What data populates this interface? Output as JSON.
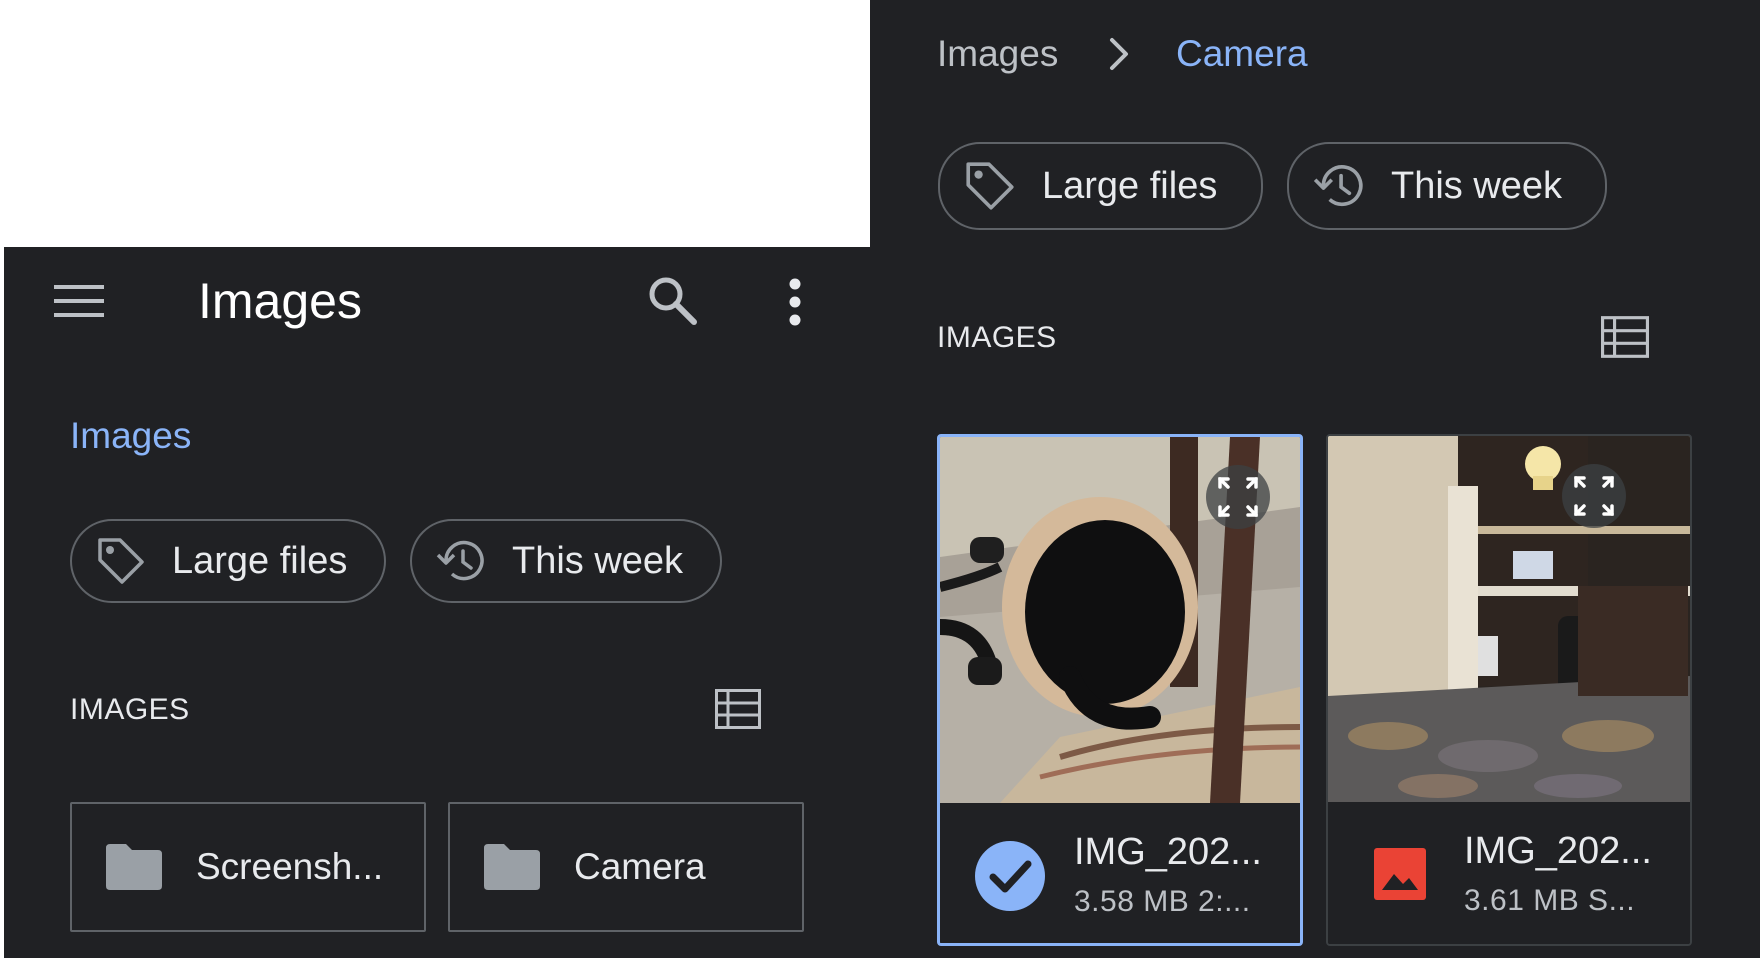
{
  "left_panel": {
    "toolbar": {
      "menu_icon": "menu-icon",
      "title": "Images",
      "search_icon": "search-icon",
      "overflow_icon": "more-vert-icon"
    },
    "breadcrumb": {
      "current": "Images"
    },
    "chips": [
      {
        "label": "Large files",
        "icon": "tag-icon"
      },
      {
        "label": "This week",
        "icon": "history-icon"
      }
    ],
    "section": {
      "label": "IMAGES",
      "view_icon": "list-view-icon"
    },
    "folders": [
      {
        "label": "Screensh...",
        "icon": "folder-icon"
      },
      {
        "label": "Camera",
        "icon": "folder-icon"
      }
    ]
  },
  "right_panel": {
    "breadcrumb": {
      "parent": "Images",
      "separator_icon": "chevron-right-icon",
      "current": "Camera"
    },
    "chips": [
      {
        "label": "Large files",
        "icon": "tag-icon"
      },
      {
        "label": "This week",
        "icon": "history-icon"
      }
    ],
    "section": {
      "label": "IMAGES",
      "view_icon": "list-view-icon"
    },
    "files": [
      {
        "name": "IMG_202...",
        "meta": "3.58 MB 2:...",
        "selected": true,
        "status_icon": "check-circle-icon",
        "expand_icon": "fullscreen-icon"
      },
      {
        "name": "IMG_202...",
        "meta": "3.61 MB S...",
        "selected": false,
        "status_icon": "image-file-icon",
        "expand_icon": "fullscreen-icon"
      }
    ]
  },
  "colors": {
    "background": "#202124",
    "accent": "#8ab4f8",
    "outline": "#5f6368",
    "text_primary": "#e8eaed",
    "image_icon_red": "#ea4335"
  }
}
